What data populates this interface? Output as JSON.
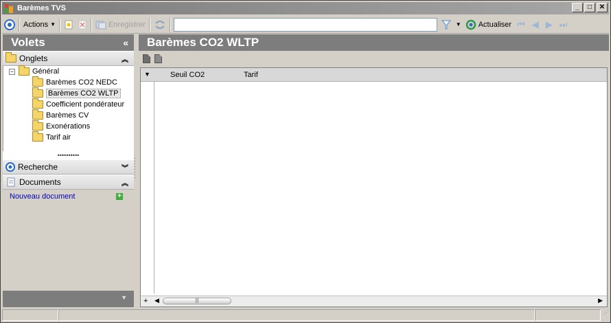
{
  "window": {
    "title": "Barèmes TVS",
    "controls": [
      "minimize",
      "maximize",
      "close"
    ]
  },
  "toolbar": {
    "actions_label": "Actions",
    "save_label": "Enregistrer",
    "search_value": "",
    "refresh_label": "Actualiser"
  },
  "left_panel": {
    "title": "Volets",
    "onglets_label": "Onglets",
    "tree": {
      "root_label": "Général",
      "items": [
        {
          "label": "Barèmes CO2 NEDC"
        },
        {
          "label": "Barèmes CO2 WLTP",
          "selected": true
        },
        {
          "label": "Coefficient pondérateur"
        },
        {
          "label": "Barèmes CV"
        },
        {
          "label": "Exonérations"
        },
        {
          "label": "Tarif air"
        }
      ]
    },
    "recherche_label": "Recherche",
    "documents_label": "Documents",
    "new_document_label": "Nouveau document"
  },
  "main": {
    "title": "Barèmes CO2 WLTP",
    "grid": {
      "columns": [
        "Seuil CO2",
        "Tarif"
      ],
      "rows": []
    }
  },
  "colors": {
    "header_bg": "#7d7d7d",
    "window_bg": "#d4d0c8",
    "link": "#0000c0",
    "accent_blue": "#2b6bc4"
  }
}
